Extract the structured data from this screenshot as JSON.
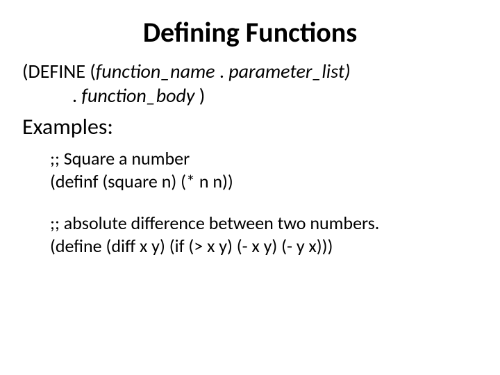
{
  "title": "Defining Functions",
  "syntax": {
    "prefix": "(DEFINE (",
    "fn_name": "function_name",
    "dot1": " . ",
    "param_list": "parameter_list)",
    "dot2": ". ",
    "fn_body": "function_body",
    "close": " )"
  },
  "examples_label": "Examples:",
  "ex1": {
    "comment": ";; Square a number",
    "code": "(definf (square n) (* n n))"
  },
  "ex2": {
    "comment": ";; absolute difference between two numbers.",
    "code": "(define (diff x y)  (if (> x y)  (- x y) (- y x)))"
  }
}
